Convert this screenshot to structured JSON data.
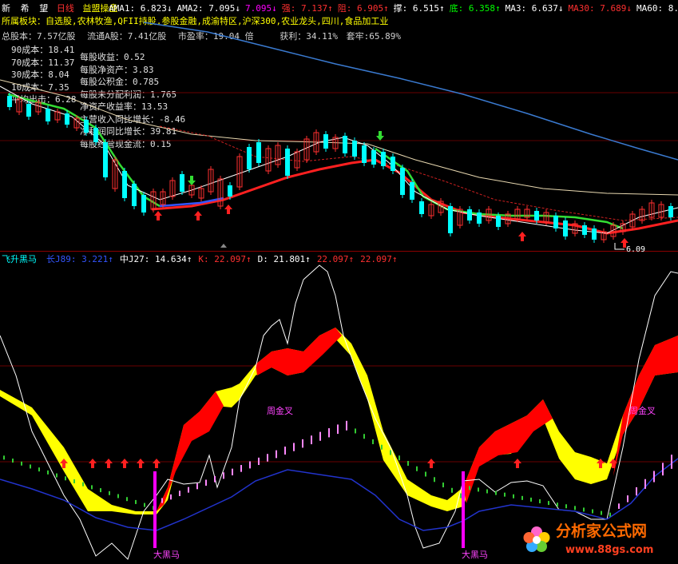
{
  "header_bar": {
    "nav": [
      "新",
      "希",
      "望"
    ],
    "period": "日线",
    "indicator_name": "益盟操盘",
    "items": [
      {
        "label": "AMA1: 6.823",
        "arrow": "↓",
        "color": "#ffffff"
      },
      {
        "label": "AMA2: 7.095",
        "arrow": "↓",
        "color": "#ffffff"
      },
      {
        "label": "7.095",
        "arrow": "↓",
        "color": "#ff00ff"
      },
      {
        "label": "强: 7.137",
        "arrow": "↑",
        "color": "#ff3030"
      },
      {
        "label": "阻: 6.905",
        "arrow": "↑",
        "color": "#ff3030"
      },
      {
        "label": "撑: 6.515",
        "arrow": "↑",
        "color": "#ffffff"
      },
      {
        "label": "底: 6.358",
        "arrow": "↑",
        "color": "#00ff00"
      },
      {
        "label": "MA3: 6.637",
        "arrow": "↓",
        "color": "#ffffff"
      },
      {
        "label": "MA30: 7.689",
        "arrow": "↓",
        "color": "#ff3030"
      },
      {
        "label": "MA60: 8.96",
        "arrow": "",
        "color": "#ffffff"
      }
    ]
  },
  "sector_line": "所属板块：自选股,农林牧渔,QFII持股,参股金融,成渝特区,沪深300,农业龙头,四川,食品加工业",
  "stats_line": {
    "total_shares": "总股本：7.57亿股",
    "float_shares": "流通A股：7.41亿股",
    "pe": "市盈率：19.04 倍",
    "profit": "获利：34.11%",
    "trapped": "套牢:65.89%"
  },
  "cost_lines": [
    "90成本：18.41",
    "70成本：11.37",
    "30成本：8.04",
    "10成本：7.35",
    "平均出击：6.28"
  ],
  "fundamentals": [
    "每股收益：0.52",
    "每股净资产：3.83",
    "每股公积金：0.785",
    "每股未分配利润：1.765",
    "净资产收益率：13.53",
    "主营收入同比增长：-8.46",
    "净利润同比增长：39.81",
    "每股经营现金流：0.15"
  ],
  "min_price_label": "6.09",
  "sub_header": {
    "name": "飞升黑马",
    "items": [
      {
        "label": "长J89: 3.221",
        "arrow": "↑",
        "color": "#3355ff"
      },
      {
        "label": "中J27: 14.634",
        "arrow": "↑",
        "color": "#ffffff"
      },
      {
        "label": "K: 22.097",
        "arrow": "↑",
        "color": "#ff3030"
      },
      {
        "label": "D: 21.801",
        "arrow": "↑",
        "color": "#ffffff"
      },
      {
        "label": "22.097",
        "arrow": "↑",
        "color": "#ff3030"
      },
      {
        "label": "22.097",
        "arrow": "↑",
        "color": "#ff3030"
      }
    ]
  },
  "annotations": {
    "golden_cross": "周金叉",
    "dark_horse": "大黑马"
  },
  "watermark": {
    "text": "分析家公式网",
    "url": "www.88gs.com"
  },
  "colors": {
    "up": "#ff3030",
    "down": "#00ffff",
    "ma_fast": "#ffffff",
    "ma_mid": "#ff2020",
    "ma_slow": "#3a7ad0",
    "ma_long": "#e8d8b0",
    "kd_up": "#ff0000",
    "kd_down": "#ffff00"
  }
}
